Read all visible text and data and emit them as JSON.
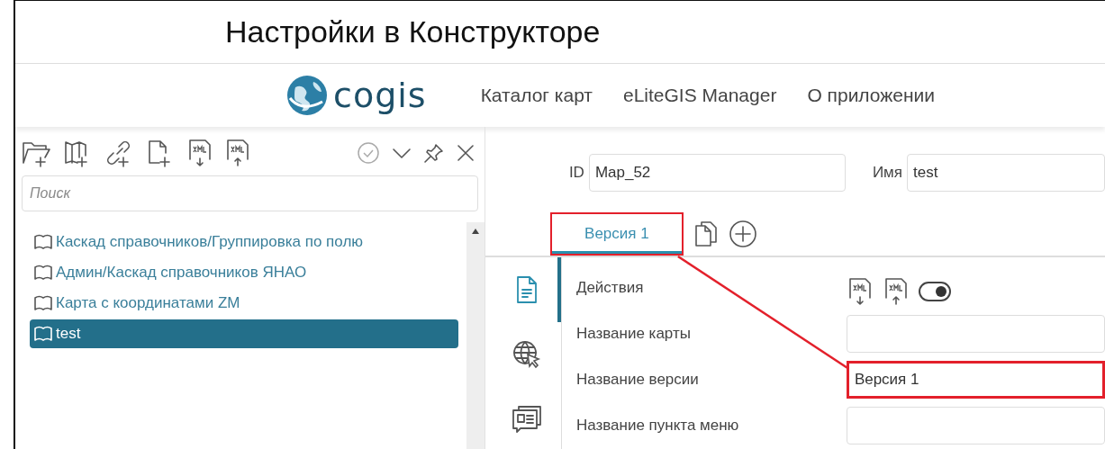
{
  "slide_title": "Настройки в Конструкторе",
  "header": {
    "logo_text": "cogis",
    "nav": [
      "Каталог карт",
      "eLiteGIS Manager",
      "О приложении"
    ]
  },
  "left_panel": {
    "search": {
      "placeholder": "Поиск"
    },
    "tree": [
      {
        "label": "Каскад справочников/Группировка по полю",
        "selected": false
      },
      {
        "label": "Админ/Каскад справочников ЯНАО",
        "selected": false
      },
      {
        "label": "Карта с координатами ZM",
        "selected": false
      },
      {
        "label": "test",
        "selected": true
      }
    ]
  },
  "form": {
    "fields": [
      {
        "label": "ID",
        "value": "Map_52"
      },
      {
        "label": "Имя",
        "value": "test"
      }
    ],
    "tabs": [
      {
        "label": "Версия 1",
        "selected": true,
        "highlighted": true
      }
    ],
    "side_tabs": [
      {
        "kind": "document",
        "selected": true
      },
      {
        "kind": "globe",
        "selected": false
      },
      {
        "kind": "news",
        "selected": false
      }
    ],
    "rows": [
      {
        "kind": "actions",
        "label": "Действия",
        "toggle_on": true
      },
      {
        "kind": "field",
        "label": "Название карты",
        "highlighted": false
      },
      {
        "kind": "field",
        "label": "Название версии",
        "value": "Версия 1",
        "highlighted": true
      },
      {
        "kind": "field",
        "label": "Название пункта меню",
        "highlighted": false
      }
    ]
  }
}
